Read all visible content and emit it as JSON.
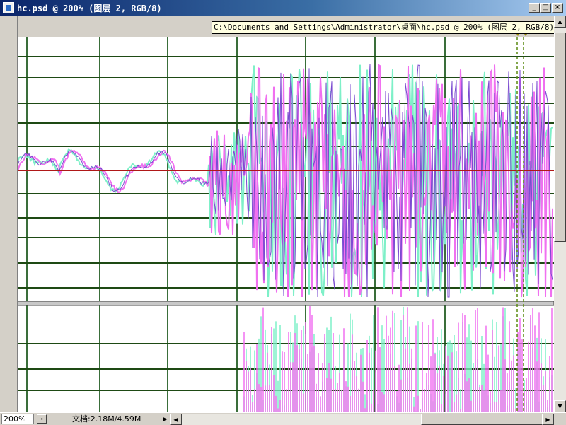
{
  "window": {
    "title": "hc.psd @ 200% (图层 2, RGB/8)",
    "minimize_glyph": "_",
    "maximize_glyph": "□",
    "close_glyph": "×"
  },
  "tooltip": {
    "text": "C:\\Documents and Settings\\Administrator\\桌面\\hc.psd @ 200% (图层 2, RGB/8)"
  },
  "status": {
    "zoom": "200%",
    "doc_size": "文档:2.18M/4.59M",
    "arrow_glyph": "▶"
  },
  "scroll": {
    "left_glyph": "◀",
    "right_glyph": "▶",
    "up_glyph": "▲",
    "down_glyph": "▼"
  },
  "colors": {
    "grid_line": "#1e4a14",
    "vertical_line": "#3a6e3a",
    "center_line": "#b01818",
    "series_a": "#f070f0",
    "series_b": "#7ef0c8",
    "series_c": "#7a4ad0",
    "guide": "#5a8a10",
    "guide_marker": "#e8e000"
  }
}
